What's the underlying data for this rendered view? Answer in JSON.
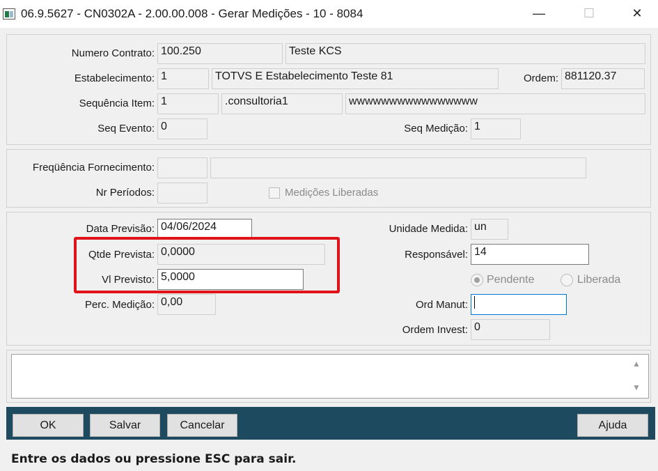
{
  "window": {
    "title": "06.9.5627 - CN0302A - 2.00.00.008 - Gerar Medições - 10 - 8084",
    "minimize": "—",
    "maximize": "☐",
    "close": "✕"
  },
  "contract": {
    "numero_contrato_label": "Numero Contrato:",
    "numero_contrato": "100.250",
    "contrato_desc": "Teste KCS",
    "estabelecimento_label": "Estabelecimento:",
    "estabelecimento": "1",
    "estabelecimento_desc": "TOTVS E Estabelecimento Teste 81",
    "ordem_label": "Ordem:",
    "ordem": "881120.37",
    "sequencia_item_label": "Sequência Item:",
    "sequencia_item": "1",
    "item_code": ".consultoria1",
    "item_desc": "wwwwwwwwwwwwwwww",
    "seq_evento_label": "Seq Evento:",
    "seq_evento": "0",
    "seq_medicao_label": "Seq Medição:",
    "seq_medicao": "1"
  },
  "frequency": {
    "frequencia_label": "Freqüência Fornecimento:",
    "frequencia": "",
    "frequencia_desc": "",
    "nr_periodos_label": "Nr Períodos:",
    "nr_periodos": "",
    "medicoes_liberadas_label": "Medições Liberadas"
  },
  "measurement": {
    "data_previsao_label": "Data Previsão:",
    "data_previsao": "04/06/2024",
    "qtde_prevista_label": "Qtde Prevista:",
    "qtde_prevista": "0,0000",
    "vl_previsto_label": "Vl Previsto:",
    "vl_previsto": "5,0000",
    "perc_medicao_label": "Perc. Medição:",
    "perc_medicao": "0,00",
    "unidade_medida_label": "Unidade Medida:",
    "unidade_medida": "un",
    "responsavel_label": "Responsável:",
    "responsavel": "14",
    "pendente_label": "Pendente",
    "liberada_label": "Liberada",
    "ord_manut_label": "Ord Manut:",
    "ord_manut": "",
    "ordem_invest_label": "Ordem Invest:",
    "ordem_invest": "0"
  },
  "notes": {
    "text": ""
  },
  "buttons": {
    "ok": "OK",
    "salvar": "Salvar",
    "cancelar": "Cancelar",
    "ajuda": "Ajuda"
  },
  "status": {
    "message": "Entre os dados ou pressione ESC para sair."
  },
  "colors": {
    "highlight": "#e0131a",
    "button_bar": "#1d4a5e",
    "focus": "#0078d7"
  }
}
